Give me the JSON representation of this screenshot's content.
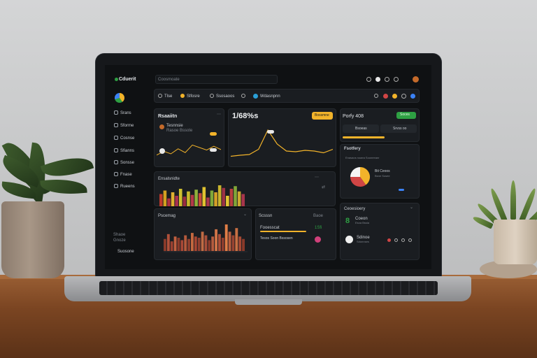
{
  "app": {
    "logo_text": "Cduerit",
    "search_text": "Coosmoate"
  },
  "sidebar": {
    "items": [
      "Srans",
      "Sforme",
      "Cosnse",
      "Sfianns",
      "Sonsse",
      "Fnase",
      "Rueens"
    ],
    "footer": [
      "Shaoe",
      "Gnoze"
    ],
    "bottom_label": "Suosone"
  },
  "toolbar": {
    "chips": [
      "Tlse",
      "Slfosre",
      "Ssosaoos",
      "Wdasnpnn"
    ]
  },
  "cards": {
    "revenue": {
      "title": "Rsaaiitn",
      "sub1": "Tesnnsie",
      "sub2": "Rasoe Bssote"
    },
    "stat": {
      "value": "1/68%s",
      "badge": "Bossmne"
    },
    "perf": {
      "title": "Porfy 408",
      "tab1": "Bsoeas",
      "tab2": "Srvss oo",
      "button": "Soces"
    },
    "overview": {
      "title": "Fsotfery",
      "sub": "Enasaos noaea Sooneeanr",
      "legend1": "Bit Ceoos",
      "legend2": "Bsne Sosee"
    },
    "bars_top": {
      "title": "Ensalsnidte"
    },
    "bars_bottom": {
      "title": "Pscemag"
    },
    "tasks": {
      "head1": "Scsssn",
      "head2": "Baoe",
      "row1": "Fooesscat",
      "row1_val": "1Sfi",
      "row2": "Tesos Soon Bssosen"
    },
    "activity": {
      "title": "Ceoesioery",
      "big": "8",
      "item1": "Coeon",
      "item1_sub": "Esoa Bssia",
      "item2": "Sdinoe",
      "item2_sub": "Sdonnses"
    }
  },
  "colors": {
    "accent_yellow": "#f2b32a",
    "accent_green": "#2ea043",
    "accent_red": "#d04545",
    "accent_blue": "#3b82f6"
  },
  "chart_data": [
    {
      "type": "bar",
      "values": [
        14,
        18,
        9,
        16,
        12,
        20,
        11,
        17,
        13,
        19,
        15,
        22,
        10,
        18,
        16,
        24,
        21,
        12,
        20,
        23,
        17,
        14
      ],
      "colors": [
        "#c0392b",
        "#d4a020",
        "#b03040",
        "#e0b030",
        "#a83050",
        "#d0c030",
        "#9b2d3f",
        "#c8b82c",
        "#b33a48",
        "#8fb03a",
        "#c44a3c",
        "#e0c230",
        "#a8384a",
        "#7fa83a",
        "#d4a028",
        "#c9b52e",
        "#9c3245",
        "#e3c534",
        "#b8403e",
        "#82a638",
        "#caa830",
        "#a9354b"
      ]
    },
    {
      "type": "bar",
      "values": [
        10,
        14,
        8,
        12,
        11,
        9,
        13,
        10,
        15,
        12,
        11,
        16,
        13,
        9,
        12,
        18,
        14,
        11,
        22,
        16,
        13,
        19,
        12,
        10
      ],
      "colors": [
        "#8a3a2a",
        "#b0503a",
        "#9a4030",
        "#c06040",
        "#8a3a2a",
        "#a84836",
        "#b45a3c",
        "#8e3e2e",
        "#c4683f",
        "#a64632",
        "#903f2f",
        "#c06b44",
        "#a9503a",
        "#8a3a2a",
        "#b65c3e",
        "#d07448",
        "#aa4e38",
        "#8f3d2d",
        "#e07d46",
        "#b85e3f",
        "#9a4431",
        "#c86f43",
        "#a64a35",
        "#8a3a2a"
      ]
    },
    {
      "type": "line",
      "values": [
        0.2,
        0.35,
        0.25,
        0.45,
        0.3,
        0.6,
        0.5,
        0.4,
        0.55,
        0.42
      ]
    },
    {
      "type": "line",
      "values": [
        0.15,
        0.18,
        0.2,
        0.35,
        0.9,
        0.5,
        0.3,
        0.28,
        0.32,
        0.3,
        0.25,
        0.35
      ]
    },
    {
      "type": "pie",
      "values": [
        40,
        35,
        25
      ],
      "colors": [
        "#f2b32a",
        "#d04545",
        "#f5f5f5"
      ]
    }
  ]
}
